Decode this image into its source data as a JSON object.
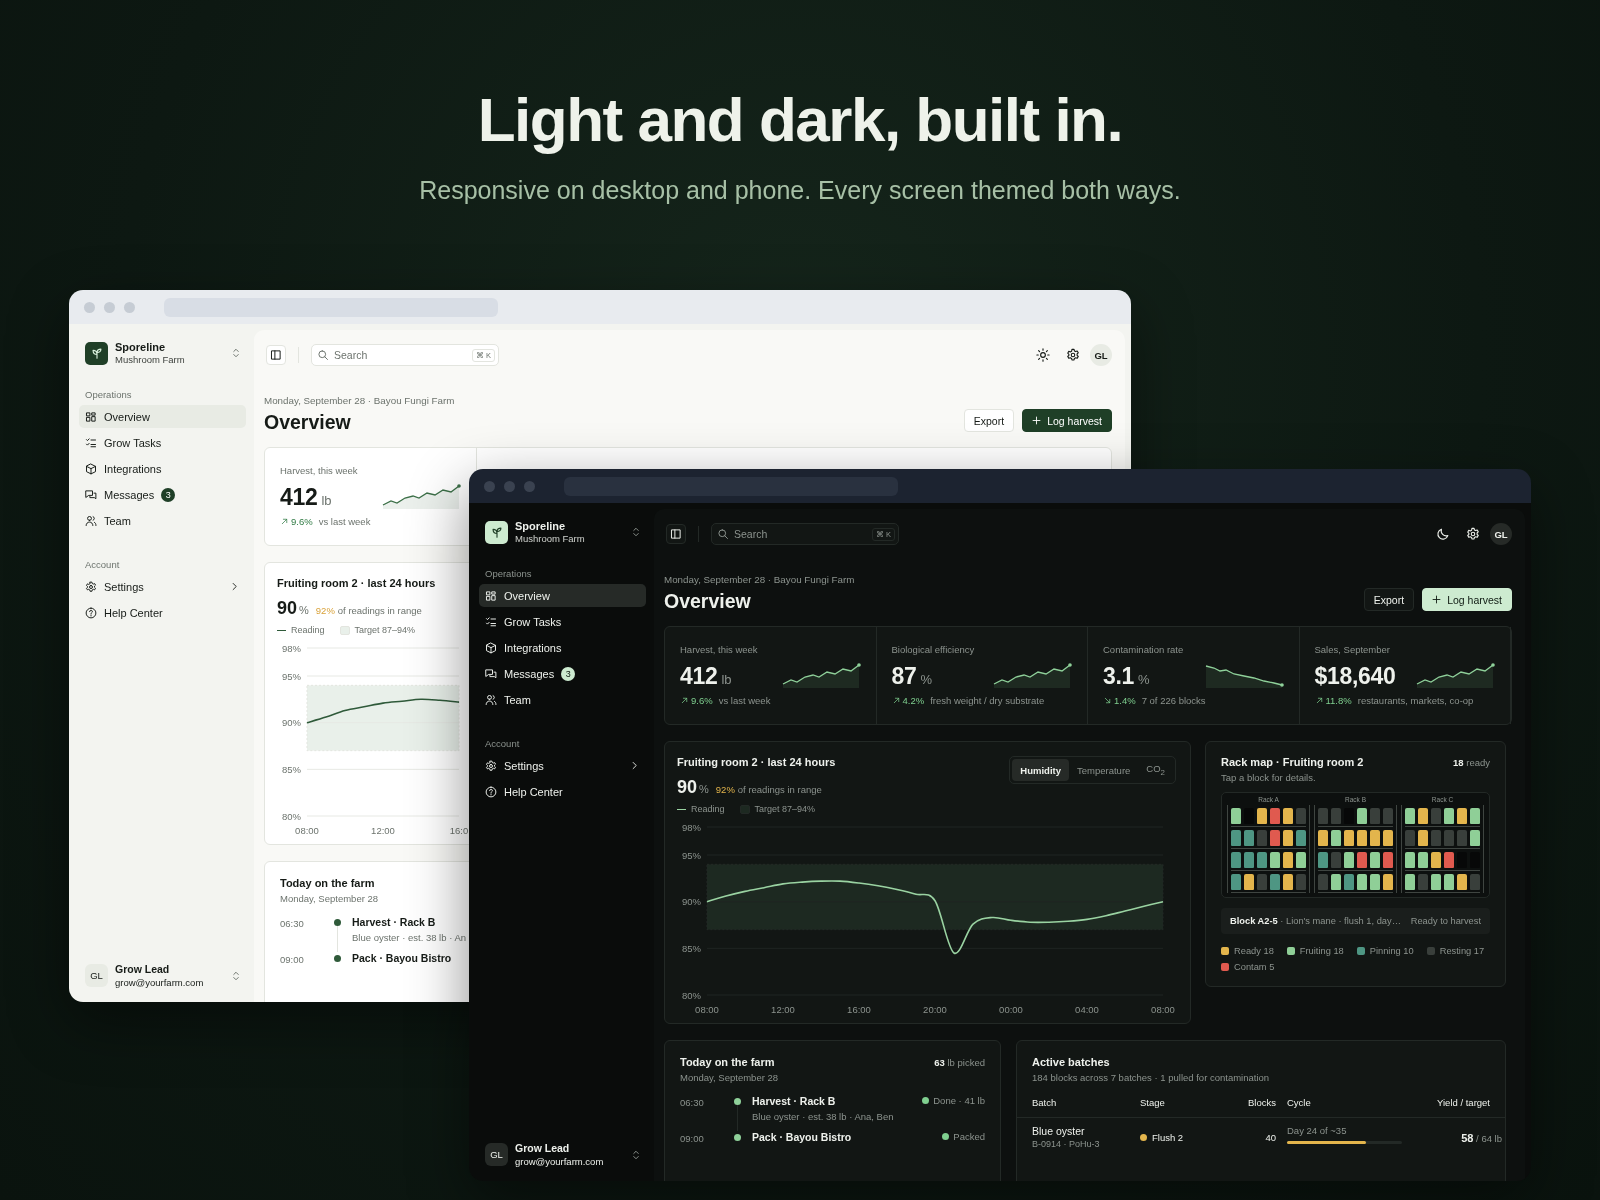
{
  "hero": {
    "title": "Light and dark, built in.",
    "subtitle": "Responsive on desktop and phone. Every screen themed both ways."
  },
  "windows": [
    {
      "kind": "light",
      "sidebar": {
        "brand": {
          "name": "Sporeline",
          "subtitle": "Mushroom Farm"
        },
        "sections": [
          {
            "label": "Operations",
            "items": [
              {
                "label": "Overview",
                "selected": true,
                "has_submenu": false
              },
              {
                "label": "Grow Tasks",
                "selected": false,
                "has_submenu": false
              },
              {
                "label": "Integrations",
                "selected": false,
                "has_submenu": false
              },
              {
                "label": "Messages",
                "selected": false,
                "has_submenu": false,
                "badge": "3"
              },
              {
                "label": "Team",
                "selected": false,
                "has_submenu": false
              }
            ]
          },
          {
            "label": "Account",
            "items": [
              {
                "label": "Settings",
                "selected": false,
                "has_submenu": true
              },
              {
                "label": "Help Center",
                "selected": false,
                "has_submenu": false
              }
            ]
          }
        ],
        "user": {
          "initials": "GL",
          "name": "Grow Lead",
          "email": "grow@yourfarm.com"
        }
      },
      "topbar": {
        "search": {
          "placeholder": "Search",
          "shortcut": "⌘ K"
        },
        "avatar": "GL"
      },
      "header": {
        "date": "Monday, September 28 · Bayou Fungi Farm",
        "title": "Overview",
        "buttons": [
          {
            "label": "Export",
            "kind": "secondary"
          },
          {
            "label": "Log harvest",
            "kind": "primary"
          }
        ]
      },
      "stats": [
        {
          "label": "Harvest, this week",
          "value": "412",
          "unit": "lb",
          "delta": "9.6%",
          "kind": "rising",
          "note": "vs last week"
        }
      ],
      "chart_card": {
        "title": "Fruiting room 2 · last 24 hours",
        "value": "90",
        "unit": "%",
        "in_range": "92%",
        "in_range_note": "of readings in range",
        "chart_data": {
          "type": "line",
          "categories": [
            "08:00",
            null,
            null,
            null,
            "12:00",
            null,
            null,
            null,
            "16:0"
          ],
          "ylim": [
            80,
            98
          ],
          "yticks": [
            {
              "value": 80,
              "label": "80%"
            },
            {
              "value": 85,
              "label": "85%"
            },
            {
              "value": 90,
              "label": "90%"
            },
            {
              "value": 95,
              "label": "95%"
            },
            {
              "value": 98,
              "label": "98%"
            }
          ],
          "series": [
            {
              "name": "Reading",
              "color": "#2f5a3a",
              "values": [
                90,
                90.6,
                91.3,
                91.7,
                92.1,
                92.3,
                92.5,
                92.4,
                92.2
              ]
            }
          ],
          "grid": true,
          "bands": [
            {
              "axis": "y",
              "from": 87,
              "to": 94,
              "label": "Target 87–94%"
            }
          ]
        }
      },
      "today": {
        "title": "Today on the farm",
        "date": "Monday, September 28",
        "events": [
          {
            "time": "06:30",
            "title": "Harvest · Rack B",
            "detail": "Blue oyster · est. 38 lb · An"
          },
          {
            "time": "09:00",
            "title": "Pack · Bayou Bistro"
          }
        ]
      }
    },
    {
      "kind": "dark",
      "sidebar": {
        "brand": {
          "name": "Sporeline",
          "subtitle": "Mushroom Farm"
        },
        "sections": [
          {
            "label": "Operations",
            "items": [
              {
                "label": "Overview",
                "selected": true,
                "has_submenu": false
              },
              {
                "label": "Grow Tasks",
                "selected": false,
                "has_submenu": false
              },
              {
                "label": "Integrations",
                "selected": false,
                "has_submenu": false
              },
              {
                "label": "Messages",
                "selected": false,
                "has_submenu": false,
                "badge": "3"
              },
              {
                "label": "Team",
                "selected": false,
                "has_submenu": false
              }
            ]
          },
          {
            "label": "Account",
            "items": [
              {
                "label": "Settings",
                "selected": false,
                "has_submenu": true
              },
              {
                "label": "Help Center",
                "selected": false,
                "has_submenu": false
              }
            ]
          }
        ],
        "user": {
          "initials": "GL",
          "name": "Grow Lead",
          "email": "grow@yourfarm.com"
        }
      },
      "topbar": {
        "search": {
          "placeholder": "Search",
          "shortcut": "⌘ K"
        },
        "avatar": "GL"
      },
      "header": {
        "date": "Monday, September 28 · Bayou Fungi Farm",
        "title": "Overview",
        "buttons": [
          {
            "label": "Export",
            "kind": "secondary"
          },
          {
            "label": "Log harvest",
            "kind": "primary"
          }
        ]
      },
      "stats": [
        {
          "label": "Harvest, this week",
          "value": "412",
          "unit": "lb",
          "delta": "9.6%",
          "kind": "rising",
          "note": "vs last week"
        },
        {
          "label": "Biological efficiency",
          "value": "87",
          "unit": "%",
          "delta": "4.2%",
          "kind": "rising",
          "note": "fresh weight / dry substrate"
        },
        {
          "label": "Contamination rate",
          "value": "3.1",
          "unit": "%",
          "delta": "1.4%",
          "kind": "falling",
          "note": "7 of 226 blocks"
        },
        {
          "label": "Sales, September",
          "value": "$18,640",
          "delta": "11.8%",
          "kind": "rising",
          "note": "restaurants, markets, co-op"
        }
      ],
      "chart_card": {
        "title": "Fruiting room 2 · last 24 hours",
        "value": "90",
        "unit": "%",
        "in_range": "92%",
        "in_range_note": "of readings in range",
        "tabs": [
          {
            "label": "Humidity",
            "selected": true
          },
          {
            "label": "Temperature",
            "selected": false
          },
          {
            "label": "CO$_{2}$",
            "selected": false
          }
        ],
        "chart_data": {
          "type": "line",
          "categories": [
            "08:00",
            null,
            null,
            null,
            "12:00",
            null,
            null,
            null,
            "16:00",
            null,
            null,
            null,
            "20:00",
            null,
            null,
            null,
            "00:00",
            null,
            null,
            null,
            "04:00",
            null,
            null,
            null,
            "08:00"
          ],
          "ylim": [
            80,
            98
          ],
          "yticks": [
            {
              "value": 80,
              "label": "80%"
            },
            {
              "value": 85,
              "label": "85%"
            },
            {
              "value": 90,
              "label": "90%"
            },
            {
              "value": 95,
              "label": "95%"
            },
            {
              "value": 98,
              "label": "98%"
            }
          ],
          "series": [
            {
              "name": "Reading",
              "color": "#9ad3a2",
              "values": [
                90,
                90.6,
                91.1,
                91.5,
                91.9,
                92.1,
                92.2,
                92.2,
                92,
                91.7,
                91.3,
                90.8,
                90.1,
                84.5,
                87.6,
                88.3,
                88,
                87.8,
                87.8,
                87.9,
                88.1,
                88.5,
                89,
                89.5,
                90
              ]
            }
          ],
          "grid": true,
          "bands": [
            {
              "axis": "y",
              "from": 87,
              "to": 94,
              "label": "Target 87–94%"
            }
          ]
        }
      },
      "rack_map": {
        "title": "Rack map · Fruiting room 2",
        "count": "**18** ready",
        "subtitle": "Tap a block for details.",
        "racks": [
          {
            "label": "Rack A",
            "rows": [
              [
                {
                  "color": "#8fcf97"
                },
                {
                  "color": "#070808"
                },
                {
                  "color": "#e3b54c"
                },
                {
                  "color": "#e05a4f"
                },
                {
                  "color": "#e3b54c"
                },
                {
                  "color": "#393f3b"
                }
              ],
              [
                {
                  "color": "#4e9683"
                },
                {
                  "color": "#4e9683"
                },
                {
                  "color": "#393f3b"
                },
                {
                  "color": "#e05a4f"
                },
                {
                  "color": "#e3b54c"
                },
                {
                  "color": "#4e9683"
                }
              ],
              [
                {
                  "color": "#4e9683"
                },
                {
                  "color": "#4e9683"
                },
                {
                  "color": "#4e9683"
                },
                {
                  "color": "#8fcf97"
                },
                {
                  "color": "#e3b54c"
                },
                {
                  "color": "#8fcf97"
                }
              ],
              [
                {
                  "color": "#4e9683"
                },
                {
                  "color": "#e3b54c"
                },
                {
                  "color": "#393f3b"
                },
                {
                  "color": "#4e9683"
                },
                {
                  "color": "#e3b54c"
                },
                {
                  "color": "#393f3b"
                }
              ]
            ]
          },
          {
            "label": "Rack B",
            "rows": [
              [
                {
                  "color": "#393f3b"
                },
                {
                  "color": "#393f3b"
                },
                {
                  "color": "#070808"
                },
                {
                  "color": "#8fcf97"
                },
                {
                  "color": "#393f3b"
                },
                {
                  "color": "#393f3b"
                }
              ],
              [
                {
                  "color": "#e3b54c"
                },
                {
                  "color": "#8fcf97"
                },
                {
                  "color": "#e3b54c"
                },
                {
                  "color": "#e3b54c"
                },
                {
                  "color": "#e3b54c"
                },
                {
                  "color": "#e3b54c"
                }
              ],
              [
                {
                  "color": "#4e9683"
                },
                {
                  "color": "#393f3b"
                },
                {
                  "color": "#8fcf97"
                },
                {
                  "color": "#e05a4f"
                },
                {
                  "color": "#8fcf97"
                },
                {
                  "color": "#e05a4f"
                }
              ],
              [
                {
                  "color": "#393f3b"
                },
                {
                  "color": "#8fcf97"
                },
                {
                  "color": "#4e9683"
                },
                {
                  "color": "#8fcf97"
                },
                {
                  "color": "#8fcf97"
                },
                {
                  "color": "#e3b54c"
                }
              ]
            ]
          },
          {
            "label": "Rack C",
            "rows": [
              [
                {
                  "color": "#8fcf97"
                },
                {
                  "color": "#e3b54c"
                },
                {
                  "color": "#393f3b"
                },
                {
                  "color": "#8fcf97"
                },
                {
                  "color": "#e3b54c"
                },
                {
                  "color": "#8fcf97"
                }
              ],
              [
                {
                  "color": "#393f3b"
                },
                {
                  "color": "#e3b54c"
                },
                {
                  "color": "#393f3b"
                },
                {
                  "color": "#393f3b"
                },
                {
                  "color": "#393f3b"
                },
                {
                  "color": "#8fcf97"
                }
              ],
              [
                {
                  "color": "#8fcf97"
                },
                {
                  "color": "#8fcf97"
                },
                {
                  "color": "#e3b54c"
                },
                {
                  "color": "#e05a4f"
                },
                {
                  "color": "#070808"
                },
                {
                  "color": "#070808"
                }
              ],
              [
                {
                  "color": "#8fcf97"
                },
                {
                  "color": "#393f3b"
                },
                {
                  "color": "#8fcf97"
                },
                {
                  "color": "#8fcf97"
                },
                {
                  "color": "#e3b54c"
                },
                {
                  "color": "#393f3b"
                }
              ]
            ]
          }
        ],
        "detail": "**Block A2-5** · Lion's mane · flush 1, day…",
        "detail_status": "Ready to harvest",
        "legend": [
          {
            "label": "Ready 18",
            "color": "#e3b54c"
          },
          {
            "label": "Fruiting 18",
            "color": "#8fcf97"
          },
          {
            "label": "Pinning 10",
            "color": "#4e9683"
          },
          {
            "label": "Resting 17",
            "color": "#393f3b"
          },
          {
            "label": "Contam 5",
            "color": "#e05a4f"
          }
        ]
      },
      "today": {
        "title": "Today on the farm",
        "count": "**63** lb picked",
        "date": "Monday, September 28",
        "events": [
          {
            "time": "06:30",
            "title": "Harvest · Rack B",
            "detail": "Blue oyster · est. 38 lb · Ana, Ben",
            "status": "Done · 41 lb",
            "color": "#7fcf8f"
          },
          {
            "time": "09:00",
            "title": "Pack · Bayou Bistro",
            "status": "Packed",
            "color": "#7fcf8f"
          }
        ]
      },
      "batches": {
        "title": "Active batches",
        "subtitle": "184 blocks across 7 batches · 1 pulled for contamination",
        "columns": [
          "Batch",
          "Stage",
          "Blocks",
          "Cycle",
          "Yield / target"
        ],
        "rows": [
          {
            "batch": "Blue oyster",
            "code": "B-0914 · PoHu-3",
            "stage": "Flush 2",
            "color": "#e3b54c",
            "blocks": "40",
            "cycle": "Day 24 of ~35",
            "level": 0.69,
            "yield": "**58** / 64 lb"
          }
        ]
      }
    }
  ]
}
